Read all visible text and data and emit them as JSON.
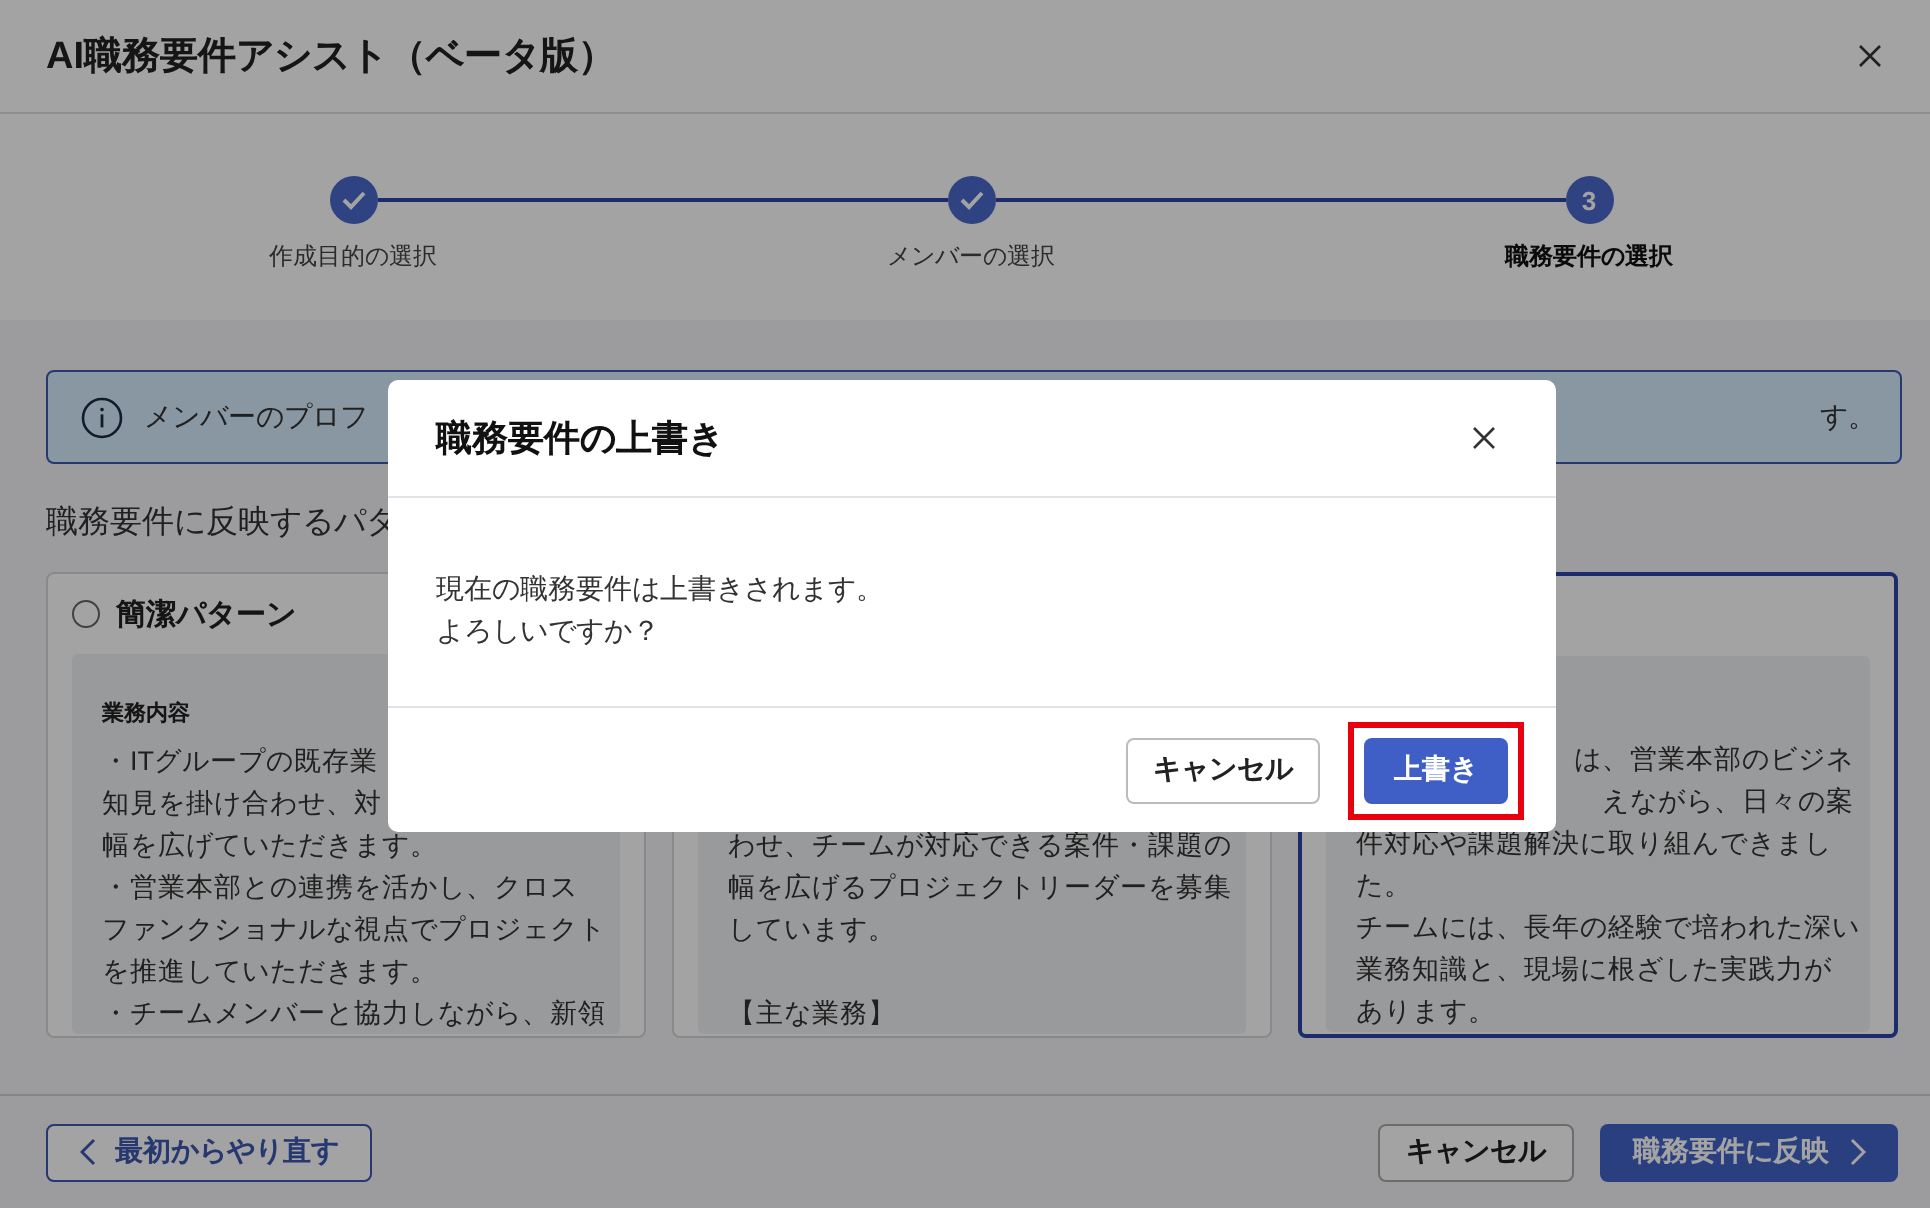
{
  "window": {
    "title": "AI職務要件アシスト（ベータ版）"
  },
  "steps": [
    {
      "label": "作成目的の選択",
      "done": true,
      "current": false
    },
    {
      "label": "メンバーの選択",
      "done": true,
      "current": false
    },
    {
      "label": "職務要件の選択",
      "done": false,
      "current": true,
      "number": "3"
    }
  ],
  "info_banner": {
    "text_start": "メンバーのプロフ",
    "text_end": "す。"
  },
  "section_label": "職務要件に反映するパタ",
  "cards": [
    {
      "title": "簡潔パターン",
      "selected": false,
      "heading": "業務内容",
      "paragraphs": [
        [
          "・ITグループの既存業",
          "知見を掛け合わせ、対",
          "幅を広げていただきます。",
          "・営業本部との連携を活かし、クロス",
          "ファンクショナルな視点でプロジェクト",
          "を推進していただきます。",
          "・チームメンバーと協力しながら、新領"
        ]
      ]
    },
    {
      "selected": false,
      "paragraphs": [
        [
          "わせ、チームが対応できる案件・課題の",
          "幅を広げるプロジェクトリーダーを募集",
          "しています。"
        ],
        [
          "【主な業務】"
        ]
      ]
    },
    {
      "selected": true,
      "line_ends": [
        "は、営業本部のビジネ",
        "えながら、日々の案"
      ],
      "paragraphs": [
        [
          "件対応や課題解決に取り組んできまし",
          "た。",
          "チームには、長年の経験で培われた深い",
          "業務知識と、現場に根ざした実践力が",
          "あります。"
        ]
      ]
    }
  ],
  "footer": {
    "back_button": "最初からやり直す",
    "cancel_button": "キャンセル",
    "apply_button": "職務要件に反映"
  },
  "dialog": {
    "title": "職務要件の上書き",
    "message": [
      "現在の職務要件は上書きされます。",
      "よろしいですか？"
    ],
    "buttons": [
      {
        "label": "キャンセル",
        "kind": "secondary",
        "highlighted": false
      },
      {
        "label": "上書き",
        "kind": "primary",
        "highlighted": true
      }
    ]
  }
}
